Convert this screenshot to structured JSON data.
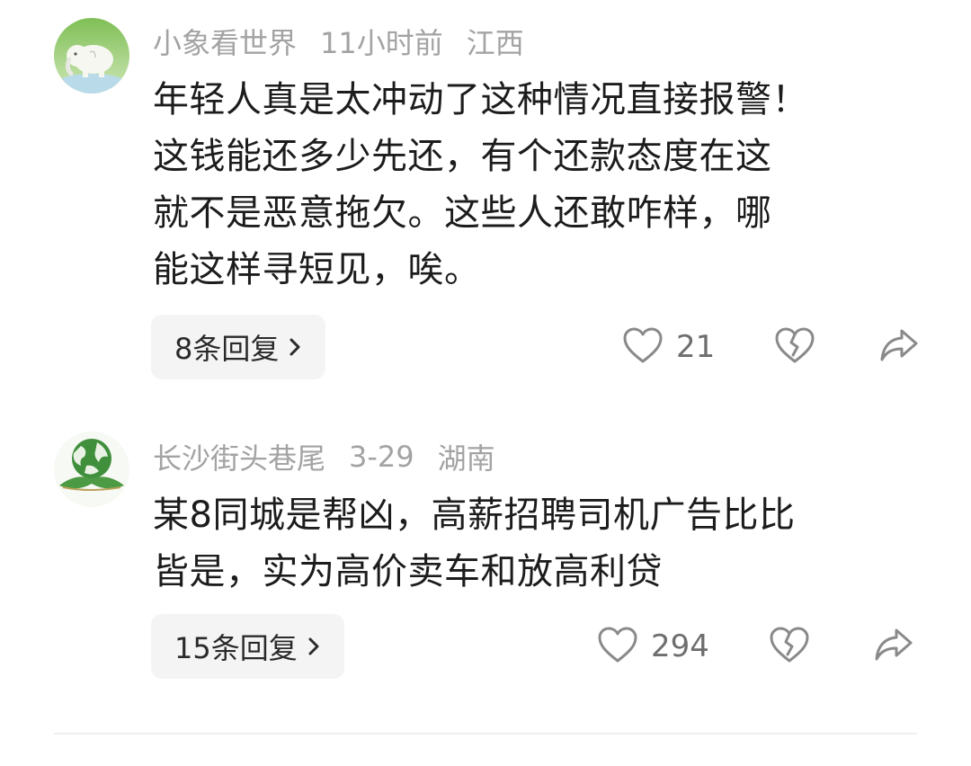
{
  "comments": [
    {
      "username": "小象看世界",
      "time": "11小时前",
      "location": "江西",
      "text_lines": [
        "年轻人真是太冲动了这种情况直接报警！",
        "这钱能还多少先还，有个还款态度在这",
        "就不是恶意拖欠。这些人还敢咋样，哪",
        "能这样寻短见，唉。"
      ],
      "replies_label": "8条回复",
      "likes": "21",
      "avatar_icon": "elephant-icon"
    },
    {
      "username": "长沙街头巷尾",
      "time": "3-29",
      "location": "湖南",
      "text_lines": [
        "某8同城是帮凶，高薪招聘司机广告比比",
        "皆是，实为高价卖车和放高利贷"
      ],
      "replies_label": "15条回复",
      "likes": "294",
      "avatar_icon": "globe-plant-icon"
    }
  ],
  "icons": {
    "like": "heart-outline-icon",
    "dislike": "broken-heart-icon",
    "share": "share-arrow-icon",
    "chevron": "chevron-right-icon"
  },
  "colors": {
    "meta": "#a3a3a3",
    "text": "#1c1c1c",
    "reply_bg": "#f4f4f4",
    "icon": "#8a8a8a"
  }
}
